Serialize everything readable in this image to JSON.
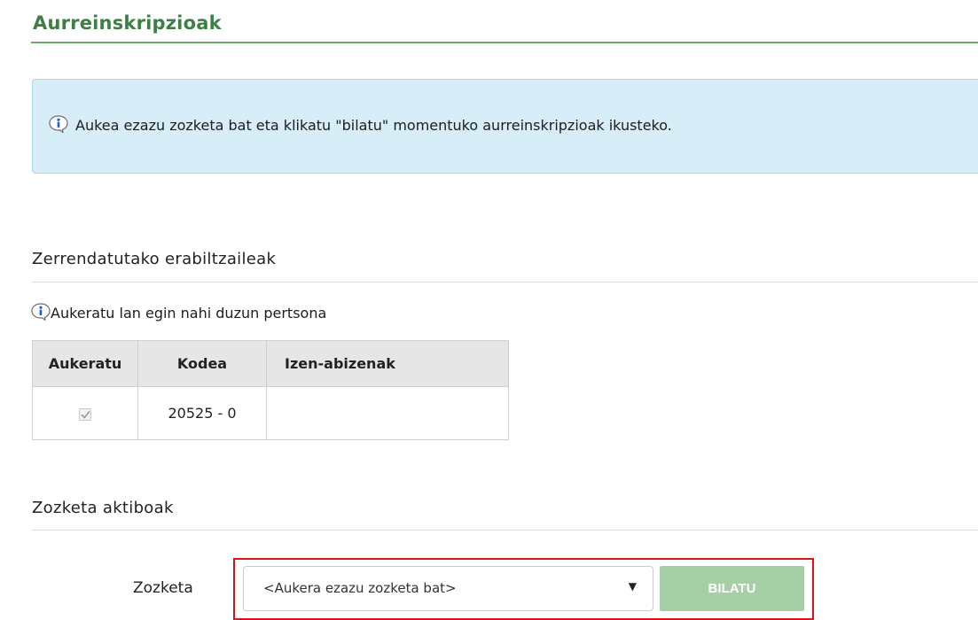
{
  "page": {
    "title": "Aurreinskripzioak"
  },
  "info_box": {
    "text": "Aukea ezazu zozketa bat eta klikatu \"bilatu\" momentuko aurreinskripzioak ikusteko."
  },
  "users_section": {
    "title": "Zerrendatutako erabiltzaileak",
    "hint": "Aukeratu lan egin nahi duzun pertsona",
    "columns": [
      "Aukeratu",
      "Kodea",
      "Izen-abizenak"
    ],
    "rows": [
      {
        "selected": true,
        "code": "20525 - 0",
        "name": ""
      }
    ]
  },
  "draws_section": {
    "title": "Zozketa aktiboak",
    "filter_label": "Zozketa",
    "select_value": "<Aukera ezazu zozketa bat>",
    "search_button": "BILATU"
  },
  "colors": {
    "title_green": "#3d7f44",
    "info_bg": "#d7edf8",
    "button_green": "#a7cfa7",
    "highlight_red": "#e0141b"
  },
  "icons": {
    "info": "info-icon",
    "checkmark": "checkmark-icon",
    "dropdown": "triangle-down-icon"
  }
}
